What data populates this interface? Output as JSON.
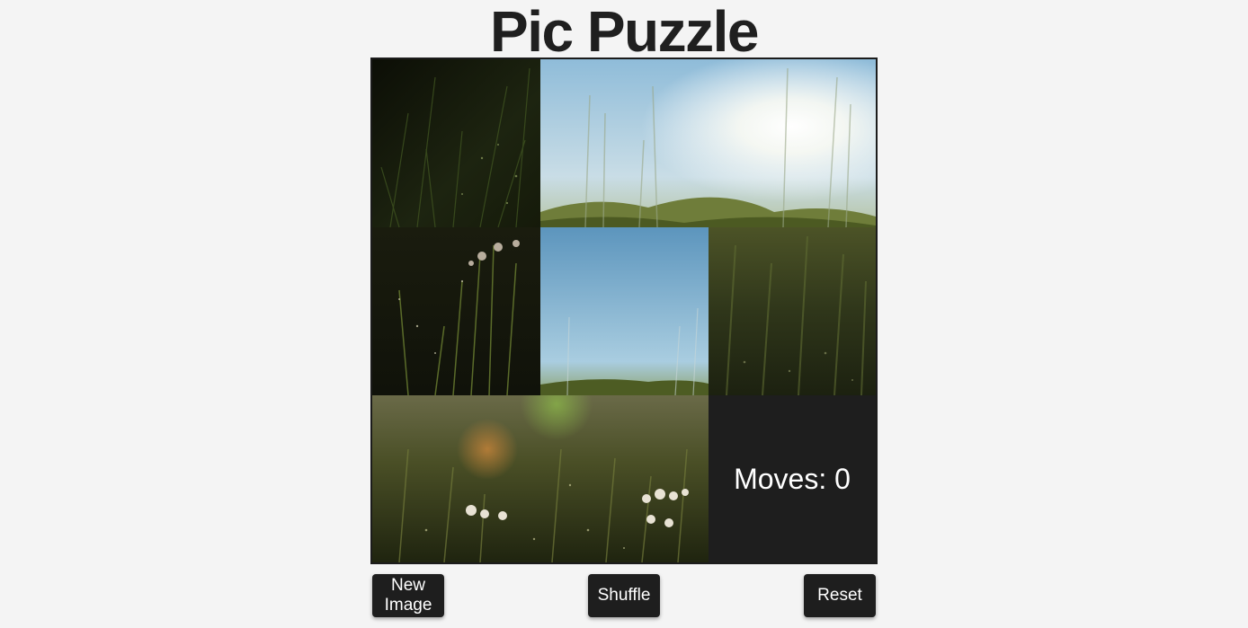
{
  "title": "Pic Puzzle",
  "moves_label": "Moves: 0",
  "buttons": {
    "new_image": "New Image",
    "shuffle": "Shuffle",
    "reset": "Reset"
  },
  "colors": {
    "background": "#f4f4f4",
    "tile_dark": "#1e1e1e",
    "button_bg": "#1e1e1e",
    "button_text": "#ffffff",
    "title_text": "#1f1f1f"
  }
}
